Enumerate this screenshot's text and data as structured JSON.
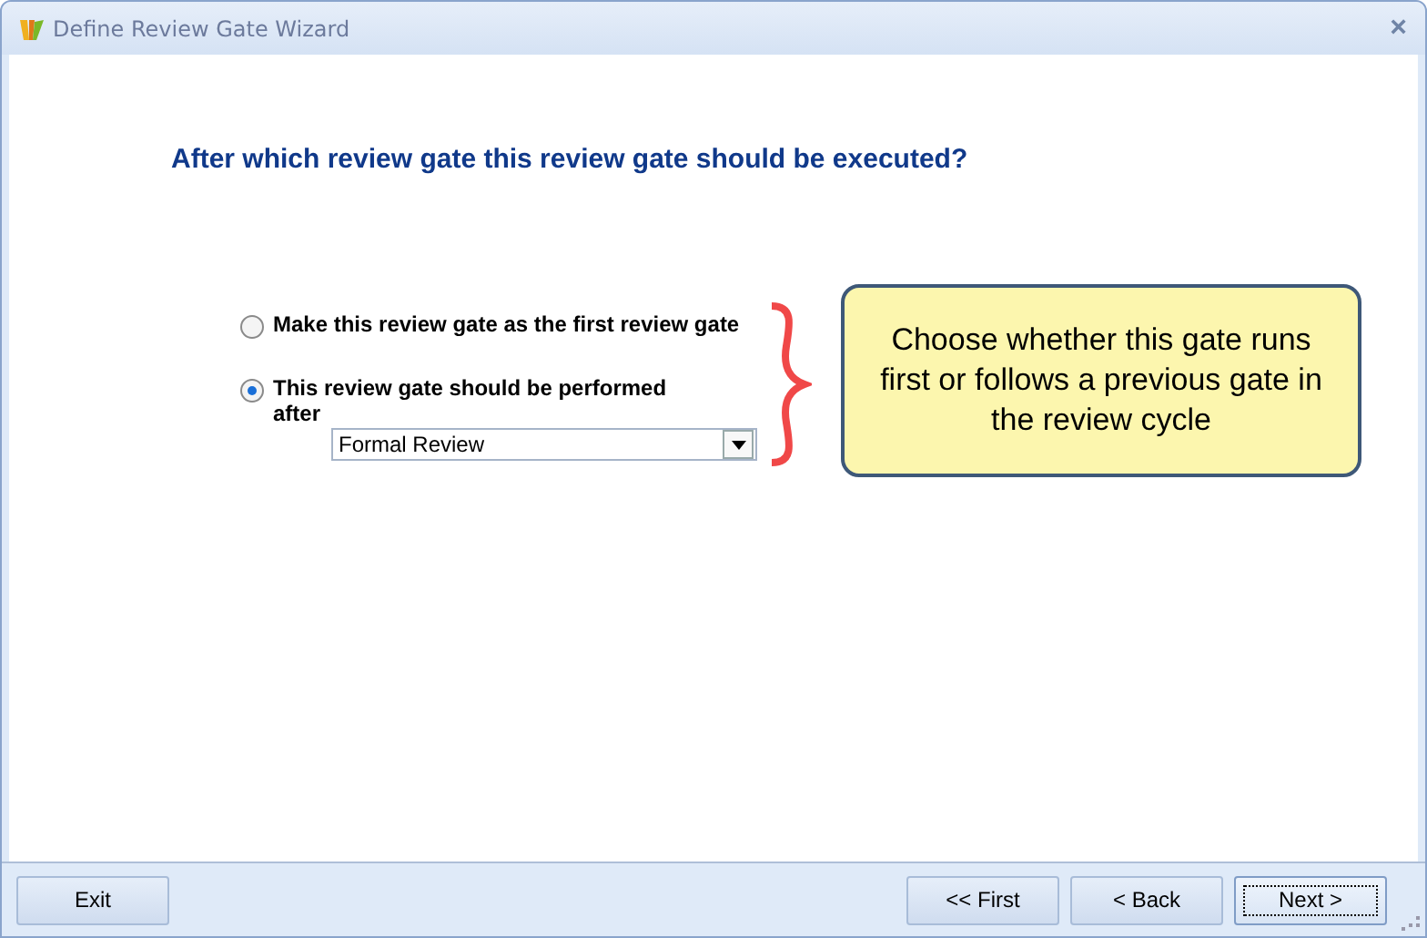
{
  "window": {
    "title": "Define Review Gate Wizard",
    "close": "×"
  },
  "heading": "After which review gate this review gate should be executed?",
  "options": [
    {
      "label": "Make this review gate as the first review gate",
      "selected": false
    },
    {
      "label": "This review gate should be performed after",
      "selected": true
    }
  ],
  "dropdown": {
    "value": "Formal Review"
  },
  "callout": "Choose whether this gate runs first or follows a previous gate in the review cycle",
  "buttons_left": [
    {
      "label": "Exit",
      "focused": false
    }
  ],
  "buttons_right": [
    {
      "label": "<< First",
      "focused": false
    },
    {
      "label": "< Back",
      "focused": false
    },
    {
      "label": "Next >",
      "focused": true
    }
  ]
}
